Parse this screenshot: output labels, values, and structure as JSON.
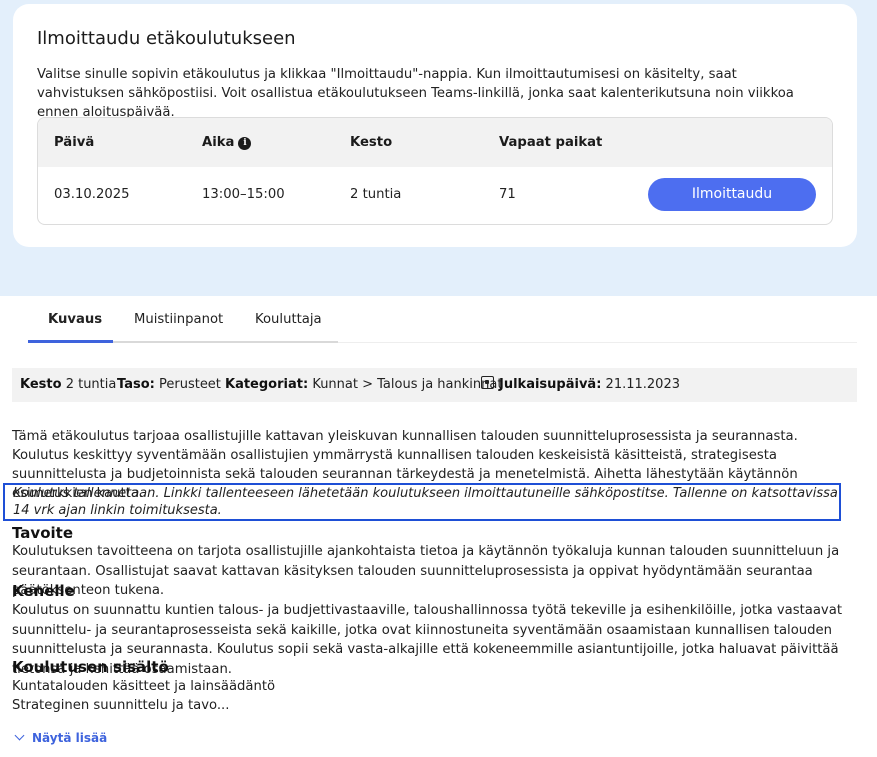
{
  "registration": {
    "title": "Ilmoittaudu etäkoulutukseen",
    "description": "Valitse sinulle sopivin etäkoulutus ja klikkaa \"Ilmoittaudu\"-nappia. Kun ilmoittautumisesi on käsitelty, saat vahvistuksen sähköpostiisi. Voit osallistua etäkoulutukseen Teams-linkillä, jonka saat kalenterikutsuna noin viikkoa ennen aloituspäivää.",
    "headers": {
      "date": "Päivä",
      "time": "Aika",
      "duration": "Kesto",
      "seats": "Vapaat paikat"
    },
    "row": {
      "date": "03.10.2025",
      "time": "13:00–15:00",
      "duration": "2 tuntia",
      "seats": "71"
    },
    "button_label": "Ilmoittaudu"
  },
  "tabs": [
    {
      "label": "Kuvaus",
      "active": true
    },
    {
      "label": "Muistiinpanot",
      "active": false
    },
    {
      "label": "Kouluttaja",
      "active": false
    }
  ],
  "meta": {
    "duration_label": "Kesto",
    "duration_value": "2 tuntia",
    "level_label": "Taso:",
    "level_value": "Perusteet",
    "categories_label": "Kategoriat:",
    "categories_value": "Kunnat > Talous ja hankinnat",
    "published_label": "Julkaisupäivä:",
    "published_value": "21.11.2023"
  },
  "content": {
    "intro": "Tämä etäkoulutus tarjoaa osallistujille kattavan yleiskuvan kunnallisen talouden suunnitteluprosessista ja seurannasta. Koulutus keskittyy syventämään osallistujien ymmärrystä kunnallisen talouden keskeisistä käsitteistä, strategisesta suunnittelusta ja budjetoinnista sekä talouden seurannan tärkeydestä ja menetelmistä. Aihetta lähestytään käytännön esimerkkien kautta.",
    "note": "Koulutus tallennetaan. Linkki tallenteeseen lähetetään koulutukseen ilmoittautuneille sähköpostitse. Tallenne on katsottavissa 14 vrk ajan linkin toimituksesta.",
    "goal_heading": "Tavoite",
    "goal_text": "Koulutuksen tavoitteena on tarjota osallistujille ajankohtaista tietoa ja käytännön työkaluja kunnan talouden suunnitteluun ja seurantaan. Osallistujat saavat kattavan käsityksen talouden suunnitteluprosessista ja oppivat hyödyntämään seurantaa päätöksenteon tukena.",
    "audience_heading": "Kenelle",
    "audience_text": "Koulutus on suunnattu kuntien talous- ja budjettivastaaville, taloushallinnossa työtä tekeville ja esihenkilöille, jotka vastaavat suunnittelu- ja seurantaprosesseista sekä kaikille, jotka ovat kiinnostuneita syventämään osaamistaan kunnallisen talouden suunnittelusta ja seurannasta. Koulutus sopii sekä vasta-alkajille että kokeneemmille asiantuntijoille, jotka haluavat päivittää tietonsa ja kehittää osaamistaan.",
    "contents_heading": "Koulutusen sisältö",
    "contents_line1": "Kuntatalouden käsitteet ja lainsäädäntö",
    "contents_line2": "Strateginen suunnittelu ja tavo...",
    "show_more": "Näytä lisää"
  }
}
